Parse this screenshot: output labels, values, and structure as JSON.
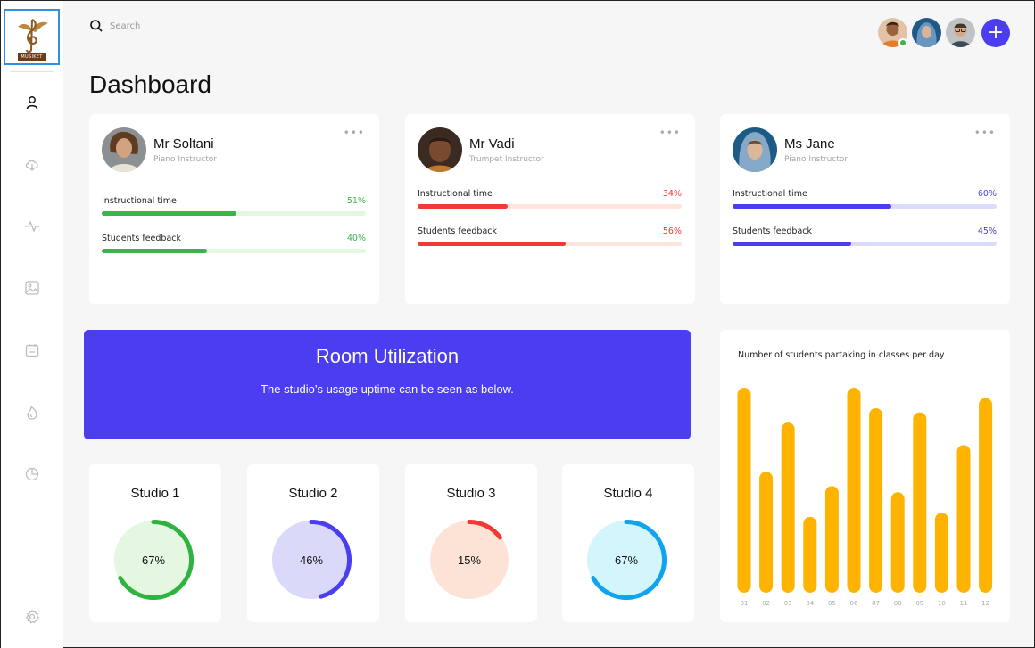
{
  "app": {
    "logo_text": "MUSIKET",
    "search_placeholder": "Search",
    "page_title": "Dashboard"
  },
  "sidebar": {
    "items": [
      {
        "icon": "user-icon",
        "active": true
      },
      {
        "icon": "download-cloud-icon",
        "active": false
      },
      {
        "icon": "activity-icon",
        "active": false
      },
      {
        "icon": "image-icon",
        "active": false
      },
      {
        "icon": "calendar-icon",
        "active": false
      },
      {
        "icon": "fire-icon",
        "active": false
      },
      {
        "icon": "pie-chart-icon",
        "active": false
      },
      {
        "icon": "settings-icon",
        "active": false
      }
    ]
  },
  "header": {
    "avatars": [
      "avatar-1",
      "avatar-2",
      "avatar-3"
    ],
    "add_button": "+"
  },
  "instructors": [
    {
      "name": "Mr Soltani",
      "role": "Piano Instructor",
      "color": "#3bb44a",
      "track": "#e3f7e1",
      "metrics": [
        {
          "label": "Instructional time",
          "pct": "51%",
          "value": 0.51
        },
        {
          "label": "Students feedback",
          "pct": "40%",
          "value": 0.4
        }
      ]
    },
    {
      "name": "Mr Vadi",
      "role": "Trumpet Instructor",
      "color": "#f03a33",
      "track": "#fde5da",
      "metrics": [
        {
          "label": "Instructional time",
          "pct": "34%",
          "value": 0.34
        },
        {
          "label": "Students feedback",
          "pct": "56%",
          "value": 0.56
        }
      ]
    },
    {
      "name": "Ms Jane",
      "role": "Piano Instructor",
      "color": "#4b3df0",
      "track": "#dcdcfa",
      "metrics": [
        {
          "label": "Instructional time",
          "pct": "60%",
          "value": 0.6
        },
        {
          "label": "Students feedback",
          "pct": "45%",
          "value": 0.45
        }
      ]
    }
  ],
  "room_utilization": {
    "title": "Room Utilization",
    "subtitle": "The studio’s usage uptime can be seen as below."
  },
  "studios": [
    {
      "name": "Studio 1",
      "label": "67%",
      "value": 0.67,
      "color": "#2fb23f",
      "fill": "#e3f7e1"
    },
    {
      "name": "Studio 2",
      "label": "46%",
      "value": 0.46,
      "color": "#4b3df0",
      "fill": "#dad9fa"
    },
    {
      "name": "Studio 3",
      "label": "15%",
      "value": 0.15,
      "color": "#f03a33",
      "fill": "#fde3d6"
    },
    {
      "name": "Studio 4",
      "label": "67%",
      "value": 0.67,
      "color": "#10a3f0",
      "fill": "#d3f6fc"
    }
  ],
  "chart_data": {
    "type": "bar",
    "title": "Number of students partaking in classes per day",
    "categories": [
      "01",
      "02",
      "03",
      "04",
      "05",
      "06",
      "07",
      "08",
      "09",
      "10",
      "11",
      "12"
    ],
    "values": [
      100,
      59,
      83,
      37,
      52,
      100,
      90,
      49,
      88,
      39,
      72,
      95
    ],
    "ylim": [
      0,
      100
    ],
    "color": "#fdb300",
    "grid": false
  }
}
